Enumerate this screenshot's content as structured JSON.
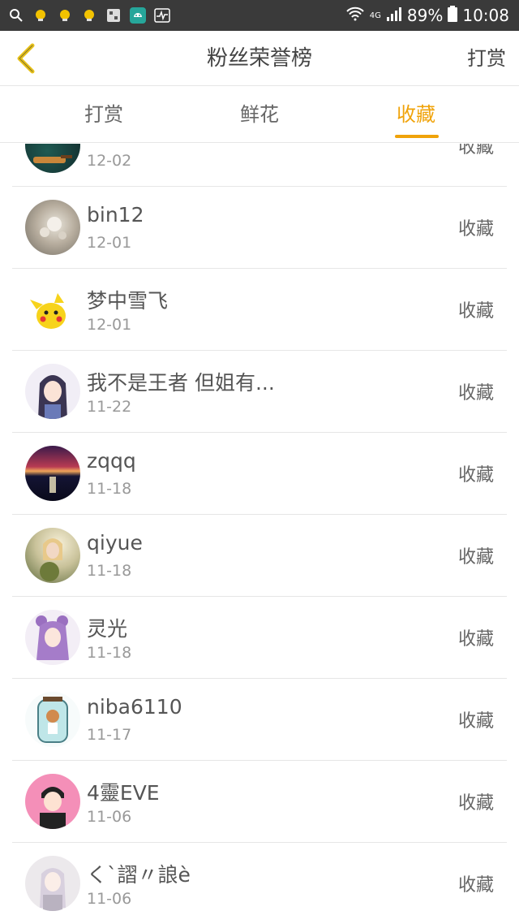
{
  "status": {
    "network": "4G",
    "battery": "89%",
    "time": "10:08"
  },
  "header": {
    "title": "粉丝荣誉榜",
    "right_action": "打赏"
  },
  "tabs": [
    {
      "label": "打赏",
      "active": false
    },
    {
      "label": "鲜花",
      "active": false
    },
    {
      "label": "收藏",
      "active": true
    }
  ],
  "colors": {
    "accent": "#f0a30a",
    "statusbar": "#3a3a3a"
  },
  "list": [
    {
      "name": "",
      "date": "12-02",
      "action": "收藏"
    },
    {
      "name": "bin12",
      "date": "12-01",
      "action": "收藏"
    },
    {
      "name": "梦中雪飞",
      "date": "12-01",
      "action": "收藏"
    },
    {
      "name": "我不是王者 但姐有...",
      "date": "11-22",
      "action": "收藏"
    },
    {
      "name": "zqqq",
      "date": "11-18",
      "action": "收藏"
    },
    {
      "name": "qiyue",
      "date": "11-18",
      "action": "收藏"
    },
    {
      "name": "灵光",
      "date": "11-18",
      "action": "收藏"
    },
    {
      "name": "niba6110",
      "date": "11-17",
      "action": "收藏"
    },
    {
      "name": "4靈EVE",
      "date": "11-06",
      "action": "收藏"
    },
    {
      "name": "く`謵〃誏è",
      "date": "11-06",
      "action": "收藏"
    }
  ]
}
